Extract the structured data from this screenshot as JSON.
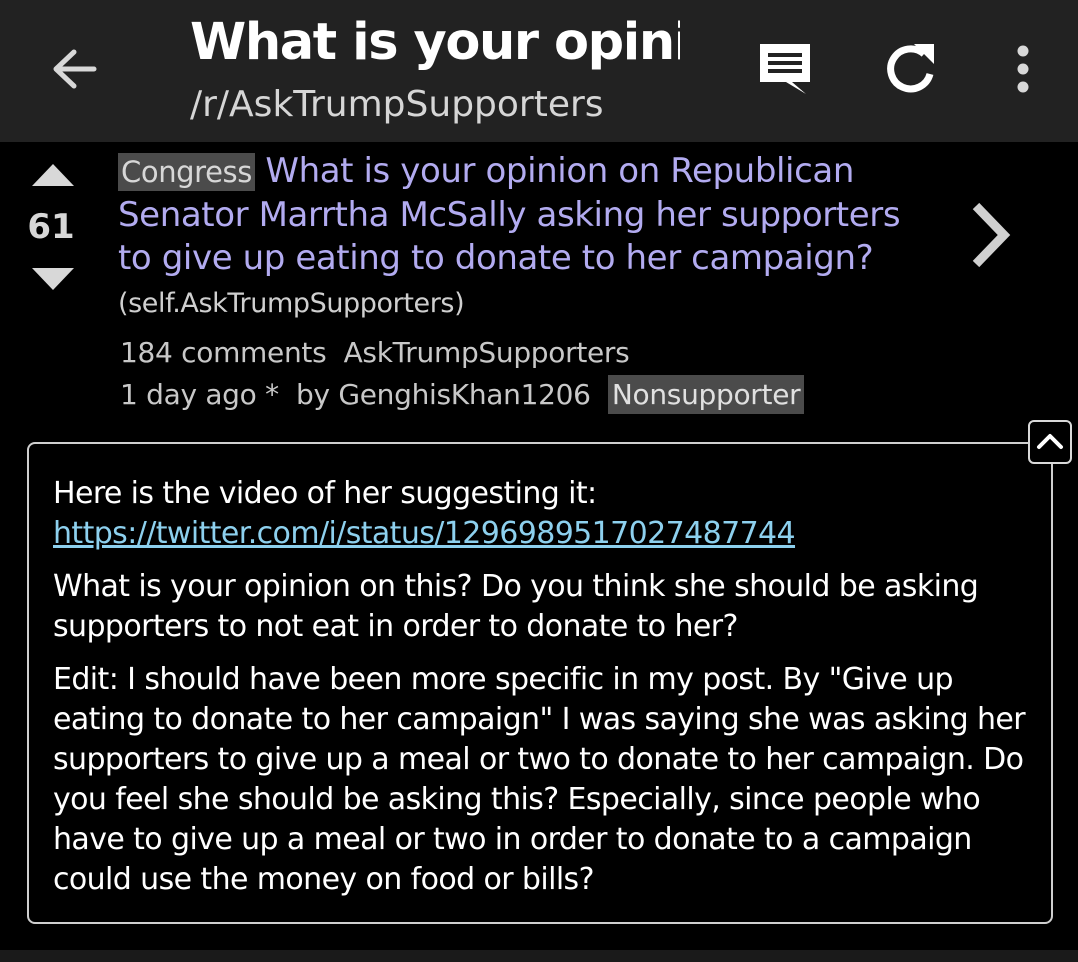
{
  "toolbar": {
    "title": "What is your opinion on Republican Senator Marrtha McSally asking her supporters to give up eating to donate to her campaign?",
    "subtitle": "/r/AskTrumpSupporters",
    "icons": [
      "back-arrow-icon",
      "comments-icon",
      "refresh-icon",
      "more-vert-icon"
    ]
  },
  "post": {
    "score": "61",
    "flair": "Congress",
    "title": "What is your opinion on Republican Senator Marrtha McSally asking her supporters to give up eating to donate to her campaign?",
    "domain": "(self.AskTrumpSupporters)",
    "comments": "184 comments",
    "subreddit": "AskTrumpSupporters",
    "age": "1 day ago *",
    "by": "by",
    "author": "GenghisKhan1206",
    "author_flair": "Nonsupporter"
  },
  "selftext": {
    "intro": "Here is the video of her suggesting it:",
    "link": "https://twitter.com/i/status/1296989517027487744",
    "p2": "What is your opinion on this? Do you think she should be asking supporters to not eat in order to donate to her?",
    "p3": "Edit: I should have been more specific in my post. By \"Give up eating to donate to her campaign\" I was saying she was asking her supporters to give up a meal or two to donate to her campaign. Do you feel she should be asking this? Especially, since people who have to give up a meal or two in order to donate to a campaign could use the money on food or bills?"
  },
  "colors": {
    "background": "#000000",
    "toolbar": "#222222",
    "title_link": "#b2abf0",
    "url_link": "#8dd0ee",
    "flair_bg": "#4b4b4b"
  }
}
